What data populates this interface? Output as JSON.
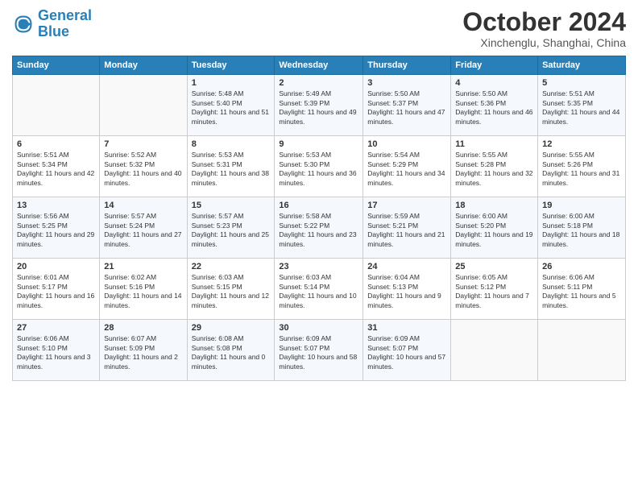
{
  "header": {
    "logo_line1": "General",
    "logo_line2": "Blue",
    "month": "October 2024",
    "location": "Xinchenglu, Shanghai, China"
  },
  "weekdays": [
    "Sunday",
    "Monday",
    "Tuesday",
    "Wednesday",
    "Thursday",
    "Friday",
    "Saturday"
  ],
  "weeks": [
    [
      {
        "day": "",
        "sunrise": "",
        "sunset": "",
        "daylight": ""
      },
      {
        "day": "",
        "sunrise": "",
        "sunset": "",
        "daylight": ""
      },
      {
        "day": "1",
        "sunrise": "Sunrise: 5:48 AM",
        "sunset": "Sunset: 5:40 PM",
        "daylight": "Daylight: 11 hours and 51 minutes."
      },
      {
        "day": "2",
        "sunrise": "Sunrise: 5:49 AM",
        "sunset": "Sunset: 5:39 PM",
        "daylight": "Daylight: 11 hours and 49 minutes."
      },
      {
        "day": "3",
        "sunrise": "Sunrise: 5:50 AM",
        "sunset": "Sunset: 5:37 PM",
        "daylight": "Daylight: 11 hours and 47 minutes."
      },
      {
        "day": "4",
        "sunrise": "Sunrise: 5:50 AM",
        "sunset": "Sunset: 5:36 PM",
        "daylight": "Daylight: 11 hours and 46 minutes."
      },
      {
        "day": "5",
        "sunrise": "Sunrise: 5:51 AM",
        "sunset": "Sunset: 5:35 PM",
        "daylight": "Daylight: 11 hours and 44 minutes."
      }
    ],
    [
      {
        "day": "6",
        "sunrise": "Sunrise: 5:51 AM",
        "sunset": "Sunset: 5:34 PM",
        "daylight": "Daylight: 11 hours and 42 minutes."
      },
      {
        "day": "7",
        "sunrise": "Sunrise: 5:52 AM",
        "sunset": "Sunset: 5:32 PM",
        "daylight": "Daylight: 11 hours and 40 minutes."
      },
      {
        "day": "8",
        "sunrise": "Sunrise: 5:53 AM",
        "sunset": "Sunset: 5:31 PM",
        "daylight": "Daylight: 11 hours and 38 minutes."
      },
      {
        "day": "9",
        "sunrise": "Sunrise: 5:53 AM",
        "sunset": "Sunset: 5:30 PM",
        "daylight": "Daylight: 11 hours and 36 minutes."
      },
      {
        "day": "10",
        "sunrise": "Sunrise: 5:54 AM",
        "sunset": "Sunset: 5:29 PM",
        "daylight": "Daylight: 11 hours and 34 minutes."
      },
      {
        "day": "11",
        "sunrise": "Sunrise: 5:55 AM",
        "sunset": "Sunset: 5:28 PM",
        "daylight": "Daylight: 11 hours and 32 minutes."
      },
      {
        "day": "12",
        "sunrise": "Sunrise: 5:55 AM",
        "sunset": "Sunset: 5:26 PM",
        "daylight": "Daylight: 11 hours and 31 minutes."
      }
    ],
    [
      {
        "day": "13",
        "sunrise": "Sunrise: 5:56 AM",
        "sunset": "Sunset: 5:25 PM",
        "daylight": "Daylight: 11 hours and 29 minutes."
      },
      {
        "day": "14",
        "sunrise": "Sunrise: 5:57 AM",
        "sunset": "Sunset: 5:24 PM",
        "daylight": "Daylight: 11 hours and 27 minutes."
      },
      {
        "day": "15",
        "sunrise": "Sunrise: 5:57 AM",
        "sunset": "Sunset: 5:23 PM",
        "daylight": "Daylight: 11 hours and 25 minutes."
      },
      {
        "day": "16",
        "sunrise": "Sunrise: 5:58 AM",
        "sunset": "Sunset: 5:22 PM",
        "daylight": "Daylight: 11 hours and 23 minutes."
      },
      {
        "day": "17",
        "sunrise": "Sunrise: 5:59 AM",
        "sunset": "Sunset: 5:21 PM",
        "daylight": "Daylight: 11 hours and 21 minutes."
      },
      {
        "day": "18",
        "sunrise": "Sunrise: 6:00 AM",
        "sunset": "Sunset: 5:20 PM",
        "daylight": "Daylight: 11 hours and 19 minutes."
      },
      {
        "day": "19",
        "sunrise": "Sunrise: 6:00 AM",
        "sunset": "Sunset: 5:18 PM",
        "daylight": "Daylight: 11 hours and 18 minutes."
      }
    ],
    [
      {
        "day": "20",
        "sunrise": "Sunrise: 6:01 AM",
        "sunset": "Sunset: 5:17 PM",
        "daylight": "Daylight: 11 hours and 16 minutes."
      },
      {
        "day": "21",
        "sunrise": "Sunrise: 6:02 AM",
        "sunset": "Sunset: 5:16 PM",
        "daylight": "Daylight: 11 hours and 14 minutes."
      },
      {
        "day": "22",
        "sunrise": "Sunrise: 6:03 AM",
        "sunset": "Sunset: 5:15 PM",
        "daylight": "Daylight: 11 hours and 12 minutes."
      },
      {
        "day": "23",
        "sunrise": "Sunrise: 6:03 AM",
        "sunset": "Sunset: 5:14 PM",
        "daylight": "Daylight: 11 hours and 10 minutes."
      },
      {
        "day": "24",
        "sunrise": "Sunrise: 6:04 AM",
        "sunset": "Sunset: 5:13 PM",
        "daylight": "Daylight: 11 hours and 9 minutes."
      },
      {
        "day": "25",
        "sunrise": "Sunrise: 6:05 AM",
        "sunset": "Sunset: 5:12 PM",
        "daylight": "Daylight: 11 hours and 7 minutes."
      },
      {
        "day": "26",
        "sunrise": "Sunrise: 6:06 AM",
        "sunset": "Sunset: 5:11 PM",
        "daylight": "Daylight: 11 hours and 5 minutes."
      }
    ],
    [
      {
        "day": "27",
        "sunrise": "Sunrise: 6:06 AM",
        "sunset": "Sunset: 5:10 PM",
        "daylight": "Daylight: 11 hours and 3 minutes."
      },
      {
        "day": "28",
        "sunrise": "Sunrise: 6:07 AM",
        "sunset": "Sunset: 5:09 PM",
        "daylight": "Daylight: 11 hours and 2 minutes."
      },
      {
        "day": "29",
        "sunrise": "Sunrise: 6:08 AM",
        "sunset": "Sunset: 5:08 PM",
        "daylight": "Daylight: 11 hours and 0 minutes."
      },
      {
        "day": "30",
        "sunrise": "Sunrise: 6:09 AM",
        "sunset": "Sunset: 5:07 PM",
        "daylight": "Daylight: 10 hours and 58 minutes."
      },
      {
        "day": "31",
        "sunrise": "Sunrise: 6:09 AM",
        "sunset": "Sunset: 5:07 PM",
        "daylight": "Daylight: 10 hours and 57 minutes."
      },
      {
        "day": "",
        "sunrise": "",
        "sunset": "",
        "daylight": ""
      },
      {
        "day": "",
        "sunrise": "",
        "sunset": "",
        "daylight": ""
      }
    ]
  ]
}
